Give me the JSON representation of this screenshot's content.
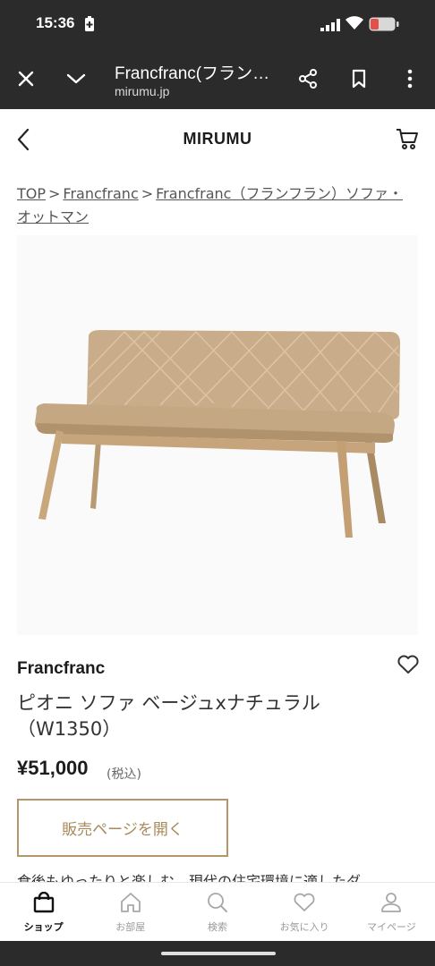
{
  "status_bar": {
    "time": "15:36"
  },
  "browser": {
    "page_title": "Francfranc(フラン…",
    "domain": "mirumu.jp"
  },
  "site": {
    "logo_text": "MIRUMU"
  },
  "breadcrumb": {
    "items": [
      "TOP",
      "Francfranc",
      "Francfranc（フランフラン）ソファ・オットマン"
    ],
    "separator": ">"
  },
  "product": {
    "brand": "Francfranc",
    "name": "ピオニ ソファ ベージュxナチュラル（W1350）",
    "price": "¥51,000",
    "tax_note": "(税込)",
    "shop_button": "販売ページを開く",
    "description": "食後もゆったりと楽しむ、現代の住宅環境に適したダ"
  },
  "tabbar": {
    "items": [
      {
        "label": "ショップ",
        "icon": "shopping-bag-icon",
        "active": true
      },
      {
        "label": "お部屋",
        "icon": "home-icon",
        "active": false
      },
      {
        "label": "検索",
        "icon": "search-icon",
        "active": false
      },
      {
        "label": "お気に入り",
        "icon": "heart-icon",
        "active": false
      },
      {
        "label": "マイページ",
        "icon": "user-icon",
        "active": false
      }
    ]
  },
  "colors": {
    "accent_gold": "#b3966a",
    "chrome_dark": "#2b2b2b",
    "battery_red": "#e0514a"
  }
}
